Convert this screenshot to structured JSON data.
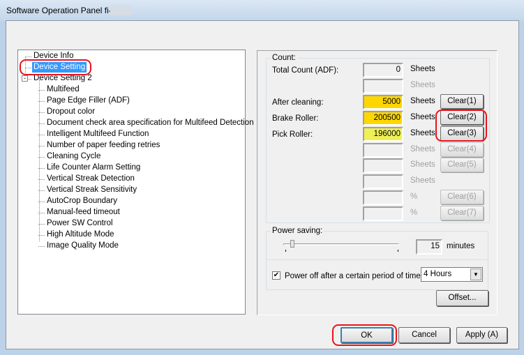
{
  "window": {
    "title": "Software Operation Panel fi-"
  },
  "tree": {
    "items": [
      {
        "label": "Device Info",
        "level": 0,
        "selected": false
      },
      {
        "label": "Device Setting",
        "level": 0,
        "selected": true
      },
      {
        "label": "Device Setting 2",
        "level": 0,
        "expanded": true
      },
      {
        "label": "Multifeed",
        "level": 1
      },
      {
        "label": "Page Edge Filler (ADF)",
        "level": 1
      },
      {
        "label": "Dropout color",
        "level": 1
      },
      {
        "label": "Document check area specification for Multifeed Detection",
        "level": 1
      },
      {
        "label": "Intelligent Multifeed Function",
        "level": 1
      },
      {
        "label": "Number of paper feeding retries",
        "level": 1
      },
      {
        "label": "Cleaning Cycle",
        "level": 1
      },
      {
        "label": "Life Counter Alarm Setting",
        "level": 1
      },
      {
        "label": "Vertical Streak Detection",
        "level": 1
      },
      {
        "label": "Vertical Streak Sensitivity",
        "level": 1
      },
      {
        "label": "AutoCrop Boundary",
        "level": 1
      },
      {
        "label": "Manual-feed timeout",
        "level": 1
      },
      {
        "label": "Power SW Control",
        "level": 1
      },
      {
        "label": "High Altitude Mode",
        "level": 1
      },
      {
        "label": "Image Quality Mode",
        "level": 1
      }
    ]
  },
  "count": {
    "legend": "Count:",
    "rows": [
      {
        "label": "Total Count (ADF):",
        "value": "0",
        "unit": "Sheets",
        "enabled": true,
        "color": ""
      },
      {
        "label": "",
        "value": "",
        "unit": "Sheets",
        "enabled": false,
        "color": ""
      },
      {
        "label": "After cleaning:",
        "value": "5000",
        "unit": "Sheets",
        "enabled": true,
        "color": "#ffd700",
        "button": "Clear(1)"
      },
      {
        "label": "Brake Roller:",
        "value": "200500",
        "unit": "Sheets",
        "enabled": true,
        "color": "#ffd700",
        "button": "Clear(2)"
      },
      {
        "label": "Pick Roller:",
        "value": "196000",
        "unit": "Sheets",
        "enabled": true,
        "color": "#eef056",
        "button": "Clear(3)"
      },
      {
        "label": "",
        "value": "",
        "unit": "Sheets",
        "enabled": false,
        "color": "",
        "button": "Clear(4)"
      },
      {
        "label": "",
        "value": "",
        "unit": "Sheets",
        "enabled": false,
        "color": "",
        "button": "Clear(5)"
      },
      {
        "label": "",
        "value": "",
        "unit": "Sheets",
        "enabled": false,
        "color": ""
      },
      {
        "label": "",
        "value": "",
        "unit": "%",
        "enabled": false,
        "color": "",
        "button": "Clear(6)"
      },
      {
        "label": "",
        "value": "",
        "unit": "%",
        "enabled": false,
        "color": "",
        "button": "Clear(7)"
      }
    ]
  },
  "power": {
    "legend": "Power saving:",
    "minutes": "15",
    "minutes_label": "minutes",
    "slider_fraction": 0.06,
    "power_off_label": "Power off after a certain period of time",
    "power_off_checked": true,
    "power_off_value": "4 Hours"
  },
  "buttons": {
    "offset": "Offset...",
    "ok": "OK",
    "cancel": "Cancel",
    "apply": "Apply (A)"
  },
  "highlight_color": "#e8141a"
}
